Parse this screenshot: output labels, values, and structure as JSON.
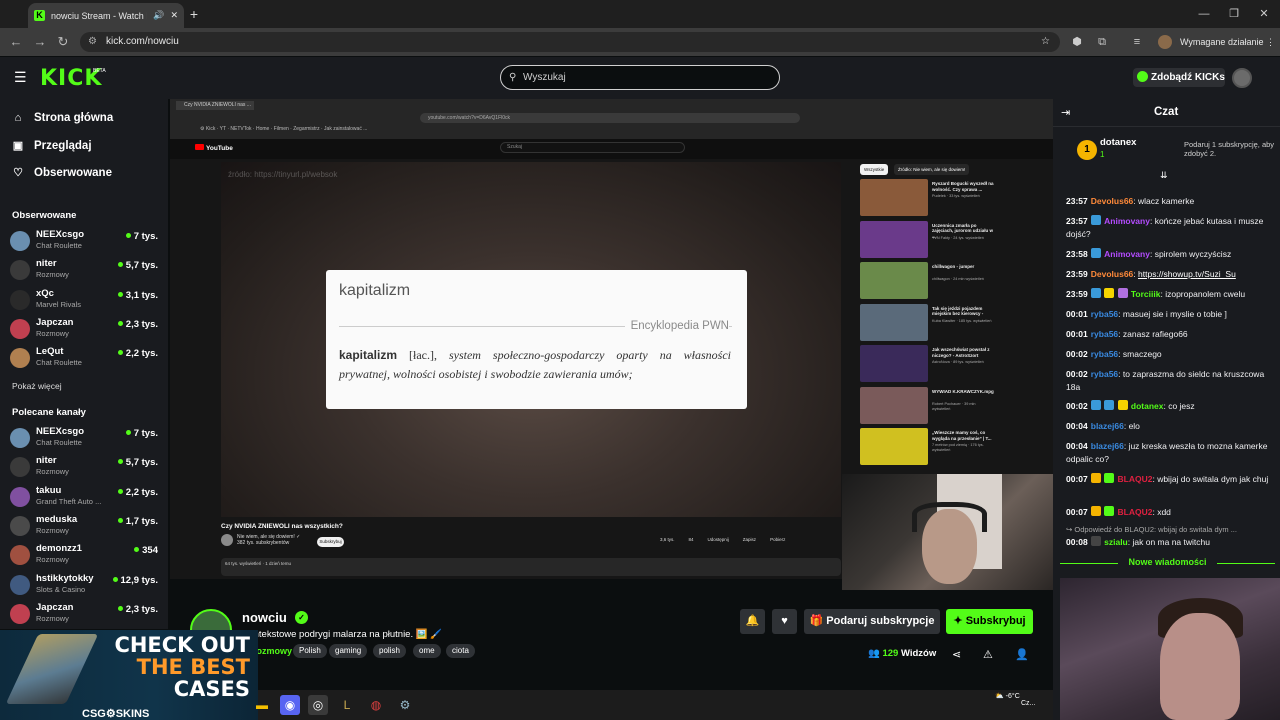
{
  "browser": {
    "tab_title": "nowciu Stream - Watch Live",
    "url": "kick.com/nowciu",
    "action_label": "Wymagane działanie"
  },
  "header": {
    "logo": "KICK",
    "beta": "BETA",
    "search_placeholder": "Wyszukaj",
    "kicks_label": "Zdobądź KICKs"
  },
  "sidebar": {
    "nav": [
      {
        "label": "Strona główna",
        "icon": "home-icon"
      },
      {
        "label": "Przeglądaj",
        "icon": "browse-icon"
      },
      {
        "label": "Obserwowane",
        "icon": "heart-icon"
      }
    ],
    "followed_title": "Obserwowane",
    "followed": [
      {
        "name": "NEEXcsgo",
        "category": "Chat Roulette",
        "viewers": "7 tys.",
        "color": "#6a8fb0"
      },
      {
        "name": "niter",
        "category": "Rozmowy",
        "viewers": "5,7 tys.",
        "color": "#3a3a3a"
      },
      {
        "name": "xQc",
        "category": "Marvel Rivals",
        "viewers": "3,1 tys.",
        "color": "#2a2a2a"
      },
      {
        "name": "Japczan",
        "category": "Rozmowy",
        "viewers": "2,3 tys.",
        "color": "#c04050"
      },
      {
        "name": "LeQut",
        "category": "Chat Roulette",
        "viewers": "2,2 tys.",
        "color": "#b08050"
      }
    ],
    "show_more": "Pokaż więcej",
    "recommended_title": "Polecane kanały",
    "recommended": [
      {
        "name": "NEEXcsgo",
        "category": "Chat Roulette",
        "viewers": "7 tys.",
        "color": "#6a8fb0"
      },
      {
        "name": "niter",
        "category": "Rozmowy",
        "viewers": "5,7 tys.",
        "color": "#3a3a3a"
      },
      {
        "name": "takuu",
        "category": "Grand Theft Auto ...",
        "viewers": "2,2 tys.",
        "color": "#8050a0"
      },
      {
        "name": "meduska",
        "category": "Rozmowy",
        "viewers": "1,7 tys.",
        "color": "#4a4a4a"
      },
      {
        "name": "demonzz1",
        "category": "Rozmowy",
        "viewers": "354",
        "color": "#a05040"
      },
      {
        "name": "hstikkytokky",
        "category": "Slots & Casino",
        "viewers": "12,9 tys.",
        "color": "#405a80"
      },
      {
        "name": "Japczan",
        "category": "Rozmowy",
        "viewers": "2,3 tys.",
        "color": "#c04050"
      }
    ]
  },
  "video": {
    "yt_url": "youtube.com/watch?v=D6AvQ1Fl0ck",
    "yt_search": "Szukaj",
    "watermark": "źródło: https://tinyurl.pl/websok",
    "encyclopedia": {
      "term": "kapitalizm",
      "source": "Encyklopedia PWN",
      "headword": "kapitalizm",
      "lang": "[łac.],",
      "definition": "system społeczno-gospodarczy oparty na własności prywatnej, wolności osobistej i swobodzie zawierania umów;"
    },
    "yt_title": "Czy NVIDIA ZNIEWOLI nas wszystkich?",
    "yt_channel": "Nie wiem, ale się dowiem! ✓",
    "yt_subscribers": "382 tys. subskrybentów",
    "yt_subscribe": "Subskrybuj",
    "yt_actions": [
      "3,6 tys.",
      "84",
      "Udostępnij",
      "Zapisz",
      "Pobierz"
    ],
    "yt_desc": "64 tys. wyświetleń · 1 dzień temu",
    "yt_chips": [
      "Wszystkie",
      "Źródło: Nie wiem, ale się dowiem!"
    ],
    "related": [
      {
        "title": "Ryszard Bogucki wyszedł na wolność. Czy sprawa ...",
        "meta": "Pudelek · 33 tys. wyświetleń",
        "color": "#8a5a3a"
      },
      {
        "title": "Uczennica zmarła po zajęciach, jurorom udziału w ...",
        "meta": "TVN Fakty · 24 tys. wyświetleń",
        "color": "#6a3a8a"
      },
      {
        "title": "chillwagon - jumper",
        "meta": "chillwagon · 24 mln wyświetleń",
        "color": "#6a8a4a"
      },
      {
        "title": "Tak się jeździ pojazdem miejskim bez kierowcy -",
        "meta": "Kuba Klawiter · 185 tys. wyświetleń",
        "color": "#5a6a7a"
      },
      {
        "title": "Jak wszechświat powstał z niczego? - AstroSzort",
        "meta": "AstroNova · 89 tys. wyświetleń",
        "color": "#3a2a5a"
      },
      {
        "title": "WYWIAD K.KRAWCZYK.mpg",
        "meta": "Robert Pochauer · 39 mln wyświetleń",
        "color": "#7a5a5a"
      },
      {
        "title": "„Wieszcze mamy coś, co wygląda na przesłanie” | T...",
        "meta": "7 metrów pod ziemią · 176 tys. wyświetleń",
        "color": "#d0c020"
      }
    ]
  },
  "stream": {
    "channel": "nowciu",
    "title": "Kontekstowe podrygi malarza na płutnie. 🖼️ 🖌️",
    "category": "Rozmowy",
    "tags": [
      "Polish",
      "gaming",
      "polish",
      "ome",
      "ciota"
    ],
    "gift_label": "Podaruj subskrypcje",
    "subscribe_label": "Subskrybuj",
    "viewers": "129",
    "viewers_label": "Widzów"
  },
  "ad": {
    "line1": "CHECK OUT",
    "line2": "THE BEST",
    "line3": "CASES",
    "brand": "CSG⚙SKINS"
  },
  "chat": {
    "title": "Czat",
    "gift_rank": "1",
    "gift_user": "dotanex",
    "gift_count": "1",
    "gift_prompt": "Podaruj 1 subskrypcję, aby zdobyć 2.",
    "messages": [
      {
        "time": "23:57",
        "user": "Devolus66",
        "color": "#ff8a3a",
        "text": "wlacz kamerke",
        "badges": []
      },
      {
        "time": "23:57",
        "user": "Animovany",
        "color": "#b44cff",
        "text": "kończe jebać kutasa i musze dojść?",
        "badges": [
          "#3a9ad9"
        ]
      },
      {
        "time": "23:58",
        "user": "Animovany",
        "color": "#b44cff",
        "text": "spirolem wyczyścisz",
        "badges": [
          "#3a9ad9"
        ]
      },
      {
        "time": "23:59",
        "user": "Devolus66",
        "color": "#ff8a3a",
        "text": "https://showup.tv/Suzi_Su",
        "badges": [],
        "link": true
      },
      {
        "time": "23:59",
        "user": "Torciiik",
        "color": "#53fc18",
        "text": "izopropanolem cwelu",
        "badges": [
          "#3a9ad9",
          "#f5d400",
          "#b070e0"
        ]
      },
      {
        "time": "00:01",
        "user": "ryba56",
        "color": "#3a8ae0",
        "text": "masuej sie i myslie o tobie ]",
        "badges": []
      },
      {
        "time": "00:01",
        "user": "ryba56",
        "color": "#3a8ae0",
        "text": "zanasz rafiego66",
        "badges": []
      },
      {
        "time": "00:02",
        "user": "ryba56",
        "color": "#3a8ae0",
        "text": "smaczego",
        "badges": []
      },
      {
        "time": "00:02",
        "user": "ryba56",
        "color": "#3a8ae0",
        "text": "to zapraszma do sieldc na kruszcowa 18a",
        "badges": []
      },
      {
        "time": "00:02",
        "user": "dotanex",
        "color": "#53fc18",
        "text": "co jesz",
        "badges": [
          "#3a9ad9",
          "#3a9ad9",
          "#f5d400"
        ]
      },
      {
        "time": "00:04",
        "user": "blazej66",
        "color": "#3a8ae0",
        "text": "elo",
        "badges": []
      },
      {
        "time": "00:04",
        "user": "blazej66",
        "color": "#3a8ae0",
        "text": "juz kreska weszła to mozna kamerke odpalic co?",
        "badges": []
      },
      {
        "time": "00:07",
        "user": "BLAQU2",
        "color": "#e02040",
        "text": "wbijaj do switala dym jak chuj",
        "badges": [
          "#f5b400",
          "#53fc18"
        ]
      },
      {
        "time": "00:07",
        "user": "BLAQU2",
        "color": "#e02040",
        "text": "xdd",
        "badges": [
          "#f5b400",
          "#53fc18"
        ]
      }
    ],
    "reply_preview": "↪ Odpowiedź do BLAQU2: wbijaj do switala dym ...",
    "last": {
      "time": "00:08",
      "user": "szialu",
      "color": "#53fc18",
      "text": "jak on ma na twitchu"
    },
    "new_messages": "Nowe wiadomości"
  },
  "taskbar": {
    "weather": "-6°C",
    "weather_sub": "Cz..."
  }
}
